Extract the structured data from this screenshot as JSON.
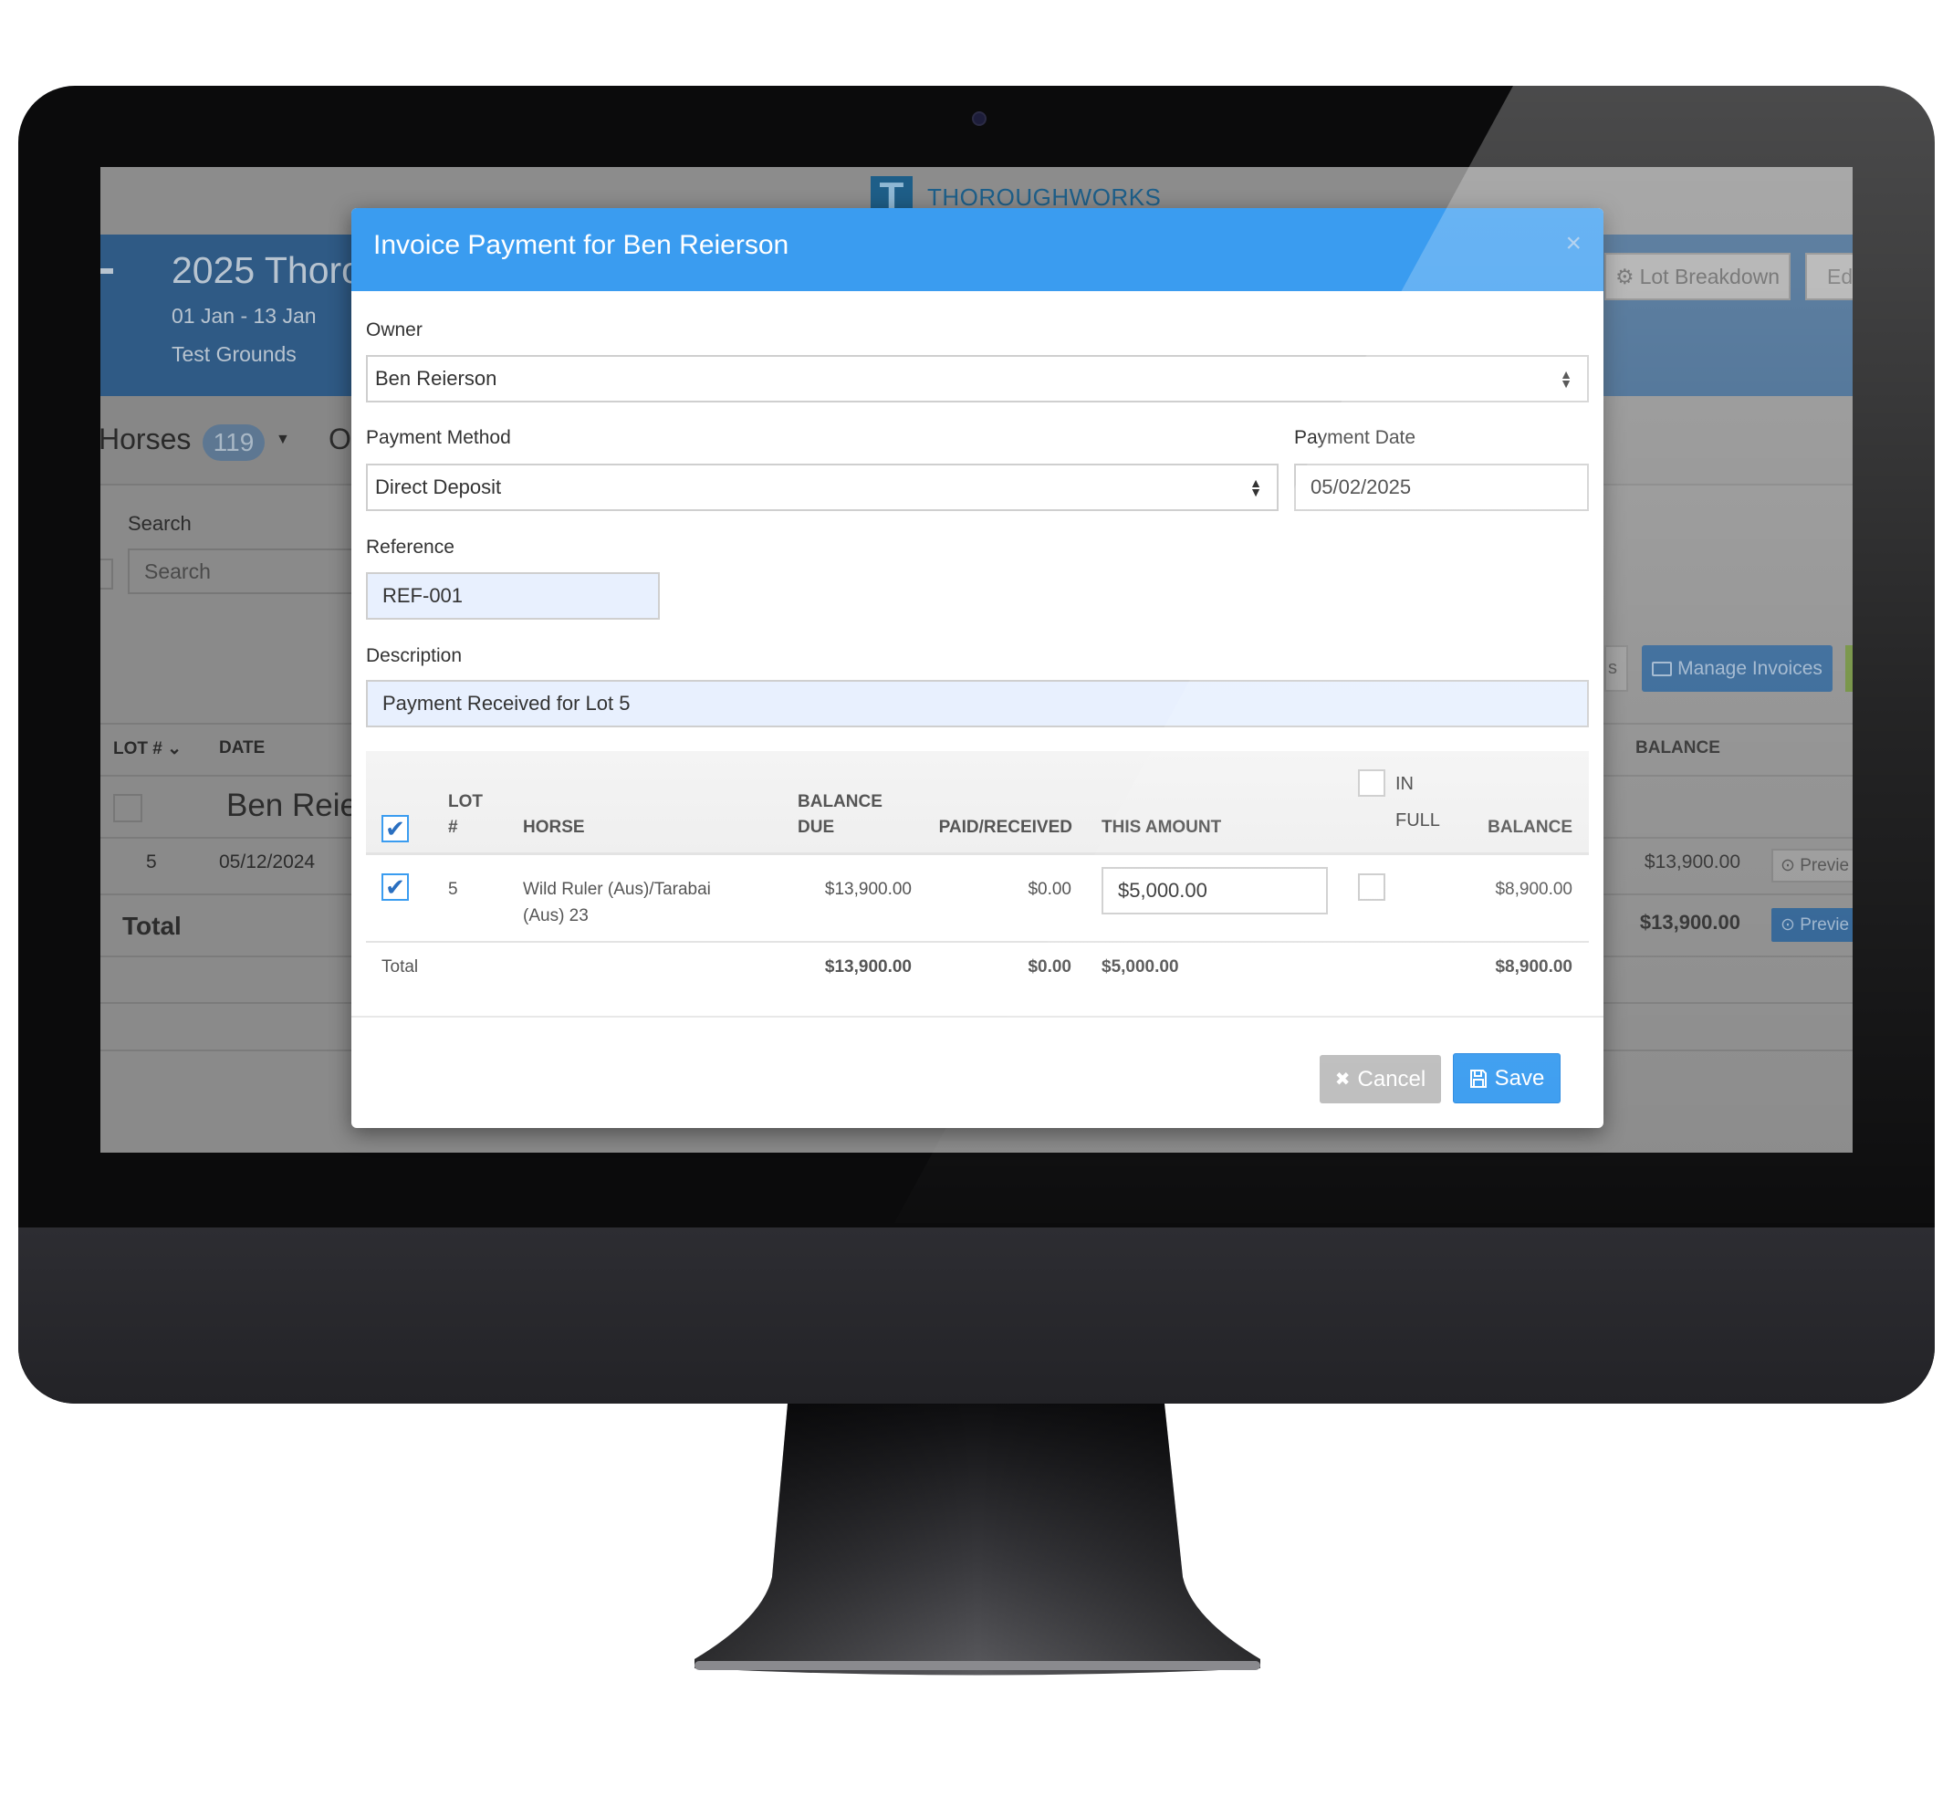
{
  "brand": {
    "logo_letter": "T",
    "name": "THOROUGHWORKS"
  },
  "background": {
    "sale_title": "2025 Thorou",
    "dates": "01 Jan - 13 Jan",
    "venue": "Test Grounds",
    "tab_horses": "Horses",
    "horses_count": "119",
    "tab_next": "O",
    "search_label": "Search",
    "search_placeholder": "Search",
    "lot_breakdown_label": "Lot Breakdown",
    "edit_label": "Edi",
    "partial_button_label": "s",
    "manage_invoices_label": "Manage Invoices",
    "table_headers": {
      "lot": "LOT #",
      "date": "DATE",
      "balance": "BALANCE"
    },
    "group_name": "Ben Reie",
    "row": {
      "lot": "5",
      "date": "05/12/2024",
      "balance": "$13,900.00",
      "preview": "Previe"
    },
    "total": {
      "label": "Total",
      "balance": "$13,900.00",
      "preview": "Previe"
    }
  },
  "modal": {
    "title": "Invoice Payment for Ben Reierson",
    "close_glyph": "×",
    "owner_label": "Owner",
    "owner_value": "Ben Reierson",
    "payment_method_label": "Payment Method",
    "payment_method_value": "Direct Deposit",
    "payment_date_label": "Payment Date",
    "payment_date_value": "05/02/2025",
    "reference_label": "Reference",
    "reference_value": "REF-001",
    "description_label": "Description",
    "description_value": "Payment Received for Lot 5",
    "table": {
      "headers": {
        "lot_1": "LOT",
        "lot_2": "#",
        "horse": "HORSE",
        "balance_due_1": "BALANCE",
        "balance_due_2": "DUE",
        "paid": "PAID/RECEIVED",
        "this_amount": "THIS AMOUNT",
        "in_full_1": "IN",
        "in_full_2": "FULL",
        "balance": "BALANCE"
      },
      "select_all_checked": true,
      "rows": [
        {
          "checked": true,
          "lot": "5",
          "horse_1": "Wild Ruler (Aus)/Tarabai",
          "horse_2": "(Aus) 23",
          "balance_due": "$13,900.00",
          "paid": "$0.00",
          "this_amount": "$5,000.00",
          "in_full": false,
          "balance": "$8,900.00"
        }
      ],
      "total": {
        "label": "Total",
        "balance_due": "$13,900.00",
        "paid": "$0.00",
        "this_amount": "$5,000.00",
        "balance": "$8,900.00"
      }
    },
    "cancel_label": "Cancel",
    "save_label": "Save"
  },
  "colors": {
    "header_blue": "#3a9cf0",
    "save_blue": "#3a9cf0",
    "cancel_gray": "#bdbdbd",
    "input_fill": "#e8f0fe",
    "check_blue": "#2a6fc0"
  }
}
